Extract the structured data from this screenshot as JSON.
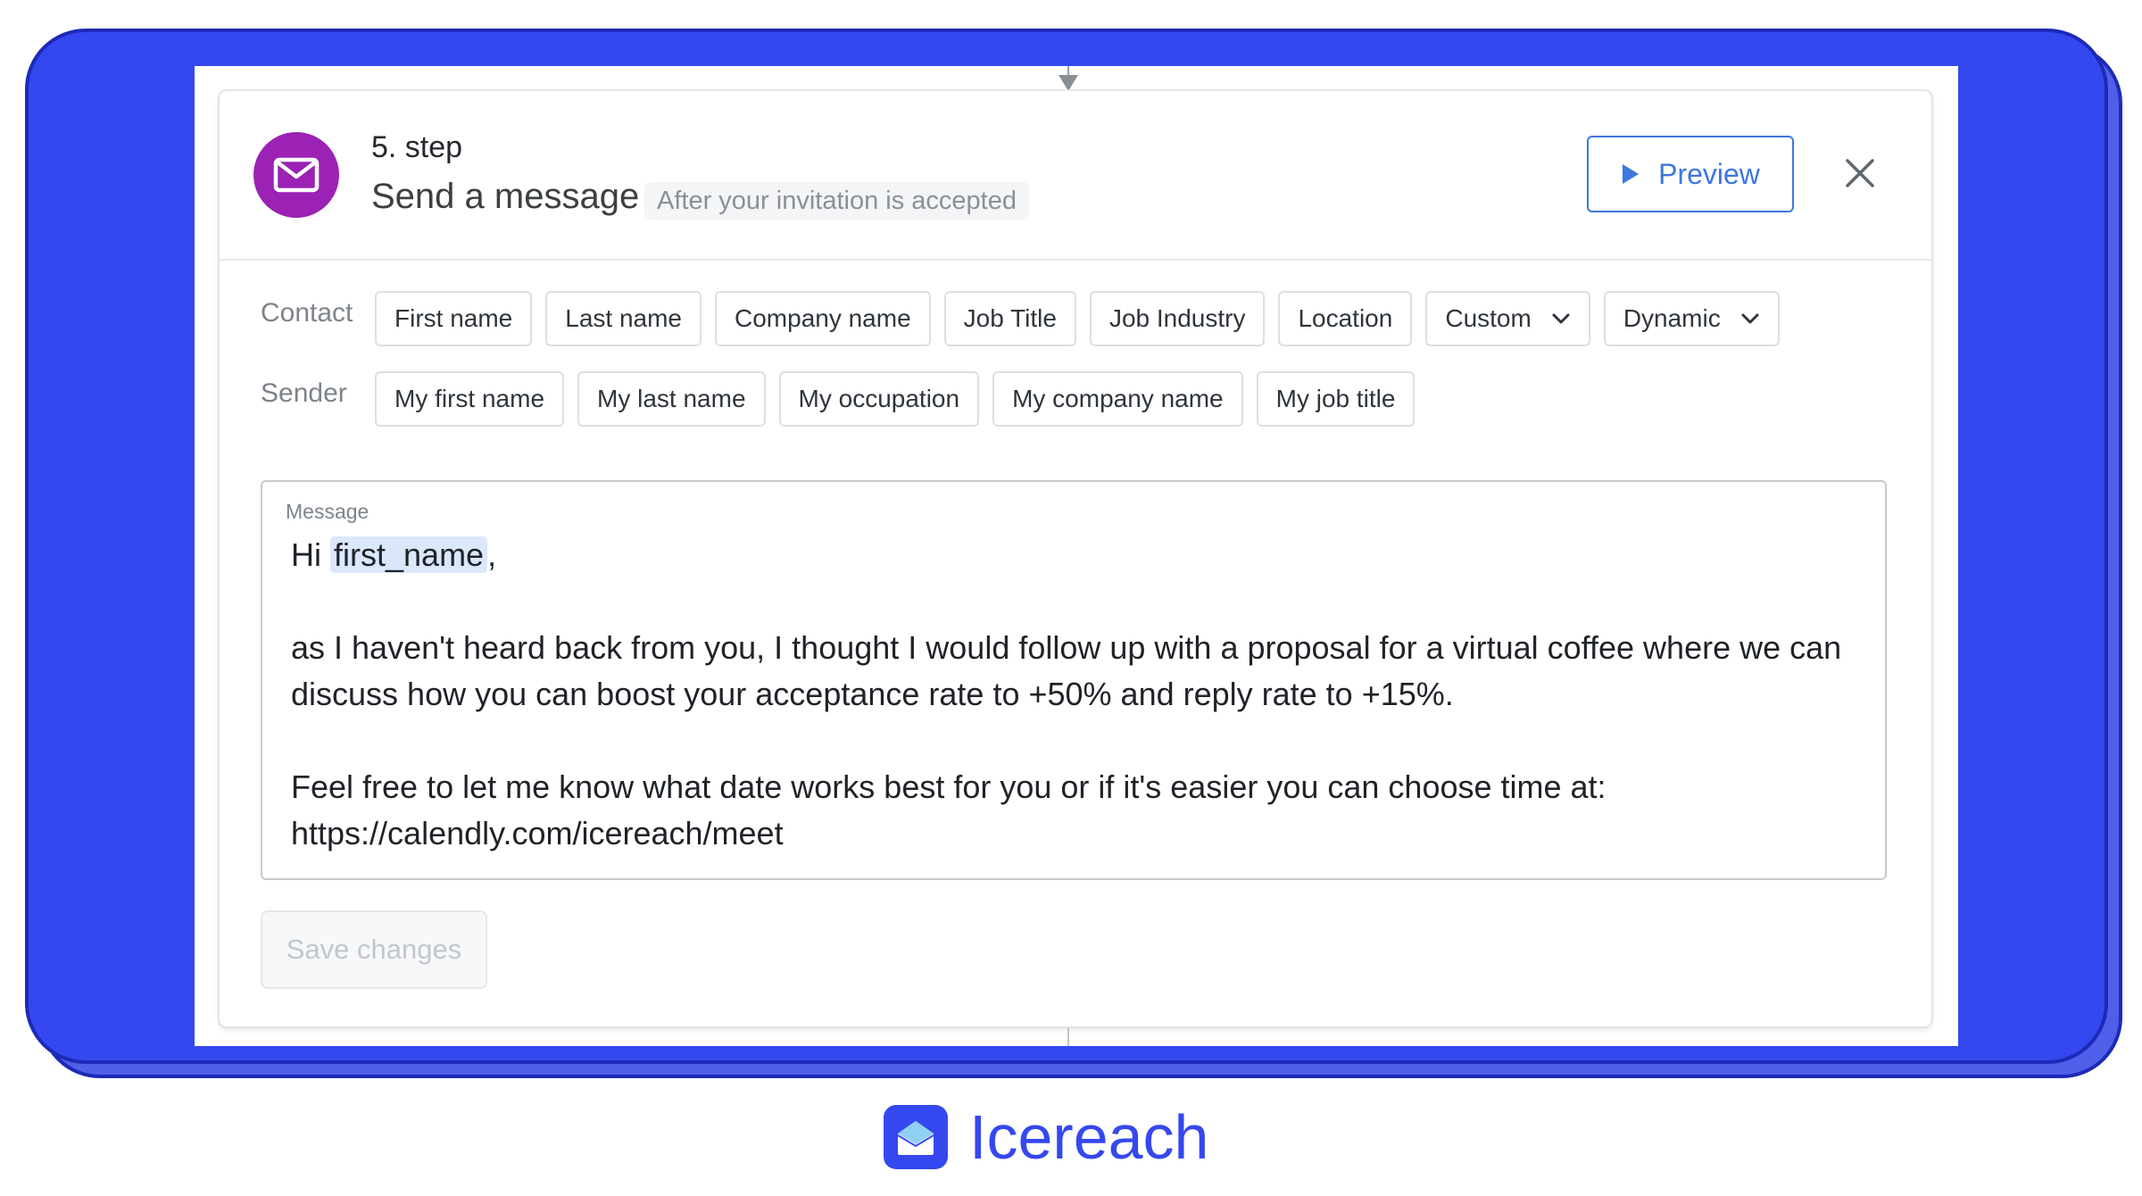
{
  "step": {
    "number_label": "5. step",
    "title": "Send a message",
    "condition": "After your invitation is accepted",
    "icon": "mail-icon",
    "icon_color": "#9b22b4"
  },
  "header": {
    "preview_label": "Preview",
    "close_icon": "close-icon",
    "accent_color": "#3d77e0"
  },
  "variables": {
    "contact_label": "Contact",
    "contact_chips": [
      "First name",
      "Last name",
      "Company name",
      "Job Title",
      "Job Industry",
      "Location"
    ],
    "contact_dropdowns": [
      "Custom",
      "Dynamic"
    ],
    "sender_label": "Sender",
    "sender_chips": [
      "My first name",
      "My last name",
      "My occupation",
      "My company name",
      "My job title"
    ]
  },
  "message": {
    "label": "Message",
    "greeting": "Hi",
    "token": "first_name",
    "greeting_suffix": ",",
    "paragraph1": "as I haven't heard back from you, I thought I would follow up with a proposal for a virtual coffee where we can discuss how you can boost your acceptance rate to +50% and reply rate to +15%.",
    "paragraph2": "Feel free to let me know what date works best for you or if it's easier you can choose time at: https://calendly.com/icereach/meet"
  },
  "footer": {
    "save_label": "Save changes"
  },
  "brand": {
    "name": "Icereach",
    "color": "#3548ef"
  }
}
